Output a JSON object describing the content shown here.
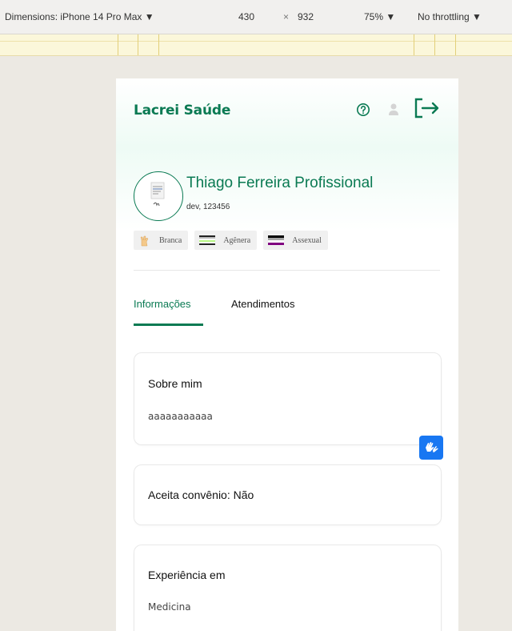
{
  "devtools": {
    "dimensions_label": "Dimensions: iPhone 14 Pro Max ▼",
    "width": "430",
    "times": "×",
    "height": "932",
    "zoom": "75% ▼",
    "throttling": "No throttling ▼"
  },
  "app": {
    "brand": "Lacrei Saúde",
    "accent_color": "#0a7a53",
    "icons": [
      "help-icon",
      "user-icon",
      "logout-icon"
    ]
  },
  "profile": {
    "name": "Thiago Ferreira Profissional",
    "id_text": "dev, 123456",
    "tags": [
      {
        "label": "Branca",
        "icon": "hand-icon"
      },
      {
        "label": "Agênera",
        "icon": "agender-flag-icon"
      },
      {
        "label": "Assexual",
        "icon": "asexual-flag-icon"
      }
    ]
  },
  "tabs": [
    {
      "label": "Informações",
      "active": true
    },
    {
      "label": "Atendimentos",
      "active": false
    }
  ],
  "cards": [
    {
      "title": "Sobre mim",
      "text": "aaaaaaaaaaa"
    },
    {
      "title": "Aceita convênio: Não",
      "text": ""
    },
    {
      "title": "Experiência em",
      "text": "Medicina"
    }
  ],
  "accessibility_button": {
    "icon": "sign-language-icon",
    "color": "#1877f2"
  }
}
